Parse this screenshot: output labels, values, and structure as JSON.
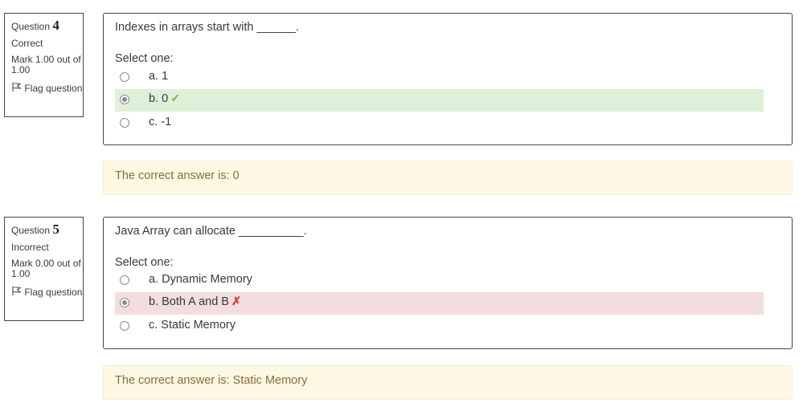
{
  "questions": [
    {
      "label": "Question",
      "number": "4",
      "state": "Correct",
      "grade": "Mark 1.00 out of 1.00",
      "flag": "Flag question",
      "text": "Indexes in arrays start with ______.",
      "prompt": "Select one:",
      "options": [
        {
          "label": "a. 1",
          "selected": false,
          "result": ""
        },
        {
          "label": "b. 0",
          "selected": true,
          "result": "correct"
        },
        {
          "label": "c. -1",
          "selected": false,
          "result": ""
        }
      ],
      "feedback": "The correct answer is: 0"
    },
    {
      "label": "Question",
      "number": "5",
      "state": "Incorrect",
      "grade": "Mark 0.00 out of 1.00",
      "flag": "Flag question",
      "text": "Java Array can allocate __________.",
      "prompt": "Select one:",
      "options": [
        {
          "label": "a. Dynamic Memory",
          "selected": false,
          "result": ""
        },
        {
          "label": "b. Both A and B",
          "selected": true,
          "result": "incorrect"
        },
        {
          "label": "c. Static Memory",
          "selected": false,
          "result": ""
        }
      ],
      "feedback": "The correct answer is: Static Memory"
    }
  ],
  "icons": {
    "correct": "check-icon",
    "incorrect": "cross-icon",
    "flag": "flag-icon"
  },
  "colors": {
    "correct_bg": "#dff0d8",
    "incorrect_bg": "#f2dede",
    "feedback_bg": "#fcf8e3",
    "check": "#7ab648",
    "cross": "#e03a3a"
  }
}
